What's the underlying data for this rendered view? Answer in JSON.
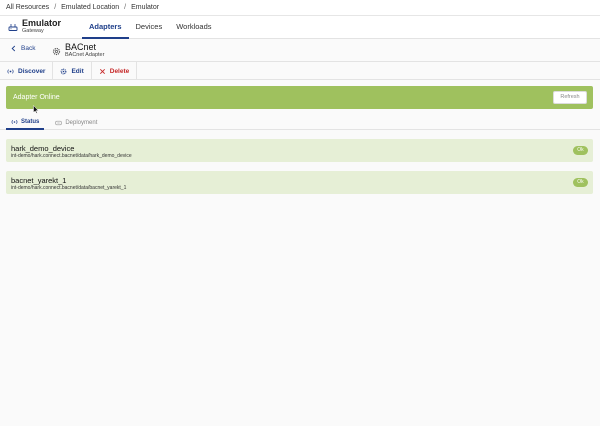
{
  "breadcrumb": {
    "items": [
      "All Resources",
      "Emulated Location",
      "Emulator"
    ],
    "separator": "/"
  },
  "header": {
    "title": "Emulator",
    "subtitle": "Gateway",
    "tabs": [
      {
        "label": "Adapters",
        "active": true
      },
      {
        "label": "Devices",
        "active": false
      },
      {
        "label": "Workloads",
        "active": false
      }
    ]
  },
  "subheader": {
    "back_label": "Back",
    "adapter_name": "BACnet",
    "adapter_type": "BACnet Adapter"
  },
  "actions": {
    "discover_label": "Discover",
    "edit_label": "Edit",
    "delete_label": "Delete"
  },
  "banner": {
    "status_text": "Adapter Online",
    "refresh_label": "Refresh",
    "color": "#9fc15e"
  },
  "subtabs": [
    {
      "label": "Status",
      "active": true
    },
    {
      "label": "Deployment",
      "active": false
    }
  ],
  "devices": [
    {
      "name": "hark_demo_device",
      "path": "int-demo/hark.connect.bacnet/data/hark_demo_device",
      "status": "Ok"
    },
    {
      "name": "bacnet_yarekt_1",
      "path": "int-demo/hark.connect.bacnet/data/bacnet_yarekt_1",
      "status": "Ok"
    }
  ],
  "colors": {
    "accent": "#1f3f8a",
    "danger": "#c62828",
    "success": "#9fc15e",
    "device_row": "#e6efd6"
  }
}
